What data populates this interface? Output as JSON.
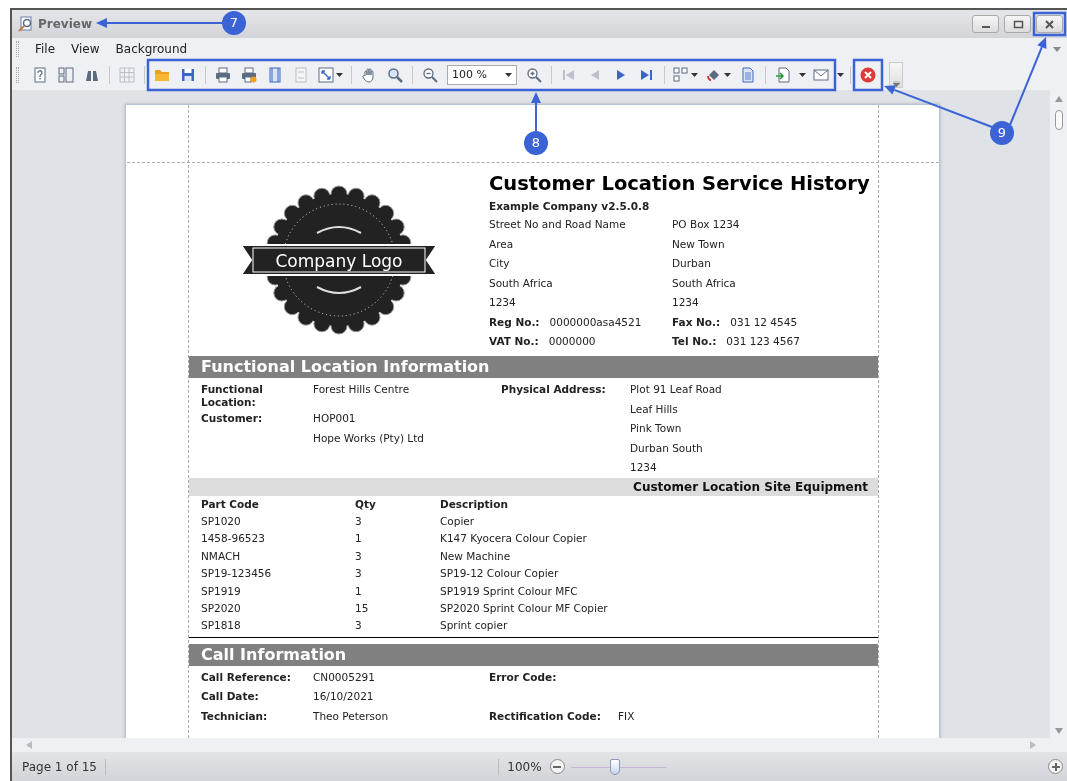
{
  "window": {
    "title": "Preview",
    "controls": [
      {
        "kind": "minimize"
      },
      {
        "kind": "maximize"
      },
      {
        "kind": "close"
      }
    ]
  },
  "menu": [
    {
      "label": "File"
    },
    {
      "label": "View"
    },
    {
      "label": "Background"
    }
  ],
  "toolbar": {
    "items": [
      {
        "kind": "button",
        "disabled": false
      },
      {
        "kind": "button",
        "disabled": false
      },
      {
        "kind": "button",
        "disabled": false
      },
      {
        "kind": "separator"
      },
      {
        "kind": "button",
        "disabled": true
      },
      {
        "kind": "separator"
      },
      {
        "kind": "button",
        "disabled": false
      },
      {
        "kind": "button",
        "disabled": false
      },
      {
        "kind": "separator"
      },
      {
        "kind": "button",
        "disabled": false
      },
      {
        "kind": "button",
        "disabled": false
      },
      {
        "kind": "button",
        "disabled": false
      },
      {
        "kind": "button",
        "disabled": true
      },
      {
        "kind": "dropdown",
        "disabled": false
      },
      {
        "kind": "separator"
      },
      {
        "kind": "button",
        "disabled": false
      },
      {
        "kind": "button",
        "disabled": false
      },
      {
        "kind": "separator"
      },
      {
        "kind": "button",
        "disabled": false
      },
      {
        "kind": "combo",
        "value": "100 %"
      },
      {
        "kind": "button",
        "disabled": false
      },
      {
        "kind": "separator"
      },
      {
        "kind": "button",
        "disabled": true
      },
      {
        "kind": "button",
        "disabled": true
      },
      {
        "kind": "button",
        "disabled": false
      },
      {
        "kind": "button",
        "disabled": false
      },
      {
        "kind": "separator"
      },
      {
        "kind": "dropdown",
        "disabled": false
      },
      {
        "kind": "dropdown",
        "disabled": false
      },
      {
        "kind": "button",
        "disabled": false
      },
      {
        "kind": "separator"
      },
      {
        "kind": "button",
        "disabled": false
      },
      {
        "kind": "arrow"
      },
      {
        "kind": "button",
        "disabled": false
      },
      {
        "kind": "arrow"
      },
      {
        "kind": "separator"
      },
      {
        "kind": "button",
        "disabled": false
      },
      {
        "kind": "overflow"
      }
    ]
  },
  "report": {
    "logo_text": "Company Logo",
    "title": "Customer Location Service History",
    "company": "Example Company v2.5.0.8",
    "address_columns": [
      [
        "Street No and Road Name",
        "Area",
        "City",
        "South Africa",
        "1234"
      ],
      [
        "PO Box 1234",
        "New Town",
        "Durban",
        "South Africa",
        "1234"
      ]
    ],
    "numbers": [
      [
        {
          "label": "Reg No.:",
          "value": "0000000asa4521"
        },
        {
          "label": "Fax No.:",
          "value": "031 12 4545"
        }
      ],
      [
        {
          "label": "VAT No.:",
          "value": "0000000"
        },
        {
          "label": "Tel No.:",
          "value": "031 123 4567"
        }
      ]
    ],
    "sections": [
      {
        "kind": "stacks",
        "title": "Functional Location Information",
        "left": [
          {
            "label": "Functional Location:",
            "values": [
              "Forest Hills Centre"
            ]
          },
          {
            "label": "Customer:",
            "values": [
              "HOP001",
              "Hope Works (Pty) Ltd"
            ]
          }
        ],
        "right": [
          {
            "label": "Physical Address:",
            "values": [
              "Plot 91 Leaf Road",
              "Leaf Hills",
              "Pink Town",
              "Durban South",
              "1234"
            ]
          }
        ]
      },
      {
        "kind": "table",
        "title": "Customer Location Site Equipment",
        "columns": [
          "Part Code",
          "Qty",
          "Description"
        ],
        "rows": [
          [
            "SP1020",
            "3",
            "Copier"
          ],
          [
            "1458-96523",
            "1",
            "K147 Kyocera Colour Copier"
          ],
          [
            "NMACH",
            "3",
            "New Machine"
          ],
          [
            "SP19-123456",
            "3",
            "SP19-12 Colour Copier"
          ],
          [
            "SP1919",
            "1",
            "SP1919 Sprint Colour MFC"
          ],
          [
            "SP2020",
            "15",
            "SP2020 Sprint Colour MF Copier"
          ],
          [
            "SP1818",
            "3",
            "Sprint copier"
          ]
        ]
      },
      {
        "kind": "rows",
        "title": "Call Information",
        "rows": [
          {
            "left": {
              "label": "Call Reference:",
              "value": "CN0005291"
            },
            "right": {
              "label": "Error Code:"
            }
          },
          {
            "left": {
              "label": "Call Date:",
              "value": "16/10/2021"
            }
          },
          {
            "left": {
              "label": "Technician:",
              "value": "Theo Peterson"
            },
            "right": {
              "label": "Rectification Code:",
              "value": "FIX"
            }
          }
        ]
      }
    ]
  },
  "status_bar": {
    "page": "Page 1 of 15",
    "zoom": "100%",
    "zoom_slider": {
      "level": 0.47
    }
  },
  "annotations": [
    {
      "number": "7"
    },
    {
      "number": "8"
    },
    {
      "number": "9"
    }
  ]
}
